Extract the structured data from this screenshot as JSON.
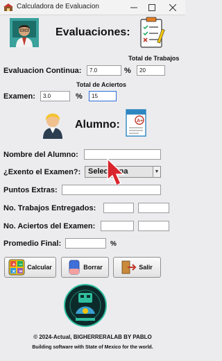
{
  "window": {
    "title": "Calculadora de Evaluacion",
    "minimize_icon": "minimize-icon",
    "maximize_icon": "maximize-icon",
    "close_icon": "close-icon"
  },
  "header": {
    "heading": "Evaluaciones:",
    "teacher_icon": "teacher-avatar-icon",
    "checklist_icon": "checklist-icon"
  },
  "grades": {
    "total_trabajos_label": "Total de Trabajos",
    "continua_label": "Evaluacion Continua:",
    "continua_value": "7.0",
    "percent_1": "%",
    "total_trabajos_value": "20",
    "total_aciertos_label": "Total de Aciertos",
    "examen_label": "Examen:",
    "examen_value": "3.0",
    "percent_2": "%",
    "total_aciertos_value": "15"
  },
  "student": {
    "heading": "Alumno:",
    "student_icon": "student-avatar-icon",
    "grade_icon": "graded-paper-icon",
    "nombre_label": "Nombre del Alumno:",
    "nombre_value": "",
    "exento_label": "¿Exento el Examen?:",
    "exento_selected": "Selecciona",
    "puntos_label": "Puntos Extras:",
    "puntos_value": "",
    "trabajos_label": "No. Trabajos Entregados:",
    "trabajos_value_1": "",
    "trabajos_value_2": "",
    "aciertos_label": "No. Aciertos del Examen:",
    "aciertos_value_1": "",
    "aciertos_value_2": "",
    "promedio_label": "Promedio Final:",
    "promedio_value": "",
    "percent_3": "%"
  },
  "actions": {
    "calcular_label": "Calcular",
    "borrar_label": "Borrar",
    "salir_label": "Salir",
    "calcular_icon": "calculator-icon",
    "borrar_icon": "eraser-icon",
    "salir_icon": "exit-icon"
  },
  "logo_icon": "bigherrerlab-logo",
  "footer": {
    "copyright": "© 2024-Actual, BIGHERRERALAB BY PABLO",
    "tagline": "Building software with State of Mexico for the world."
  },
  "colors": {
    "accent": "#2b6fd6",
    "background": "#ececef",
    "pointer": "#d9262c"
  }
}
